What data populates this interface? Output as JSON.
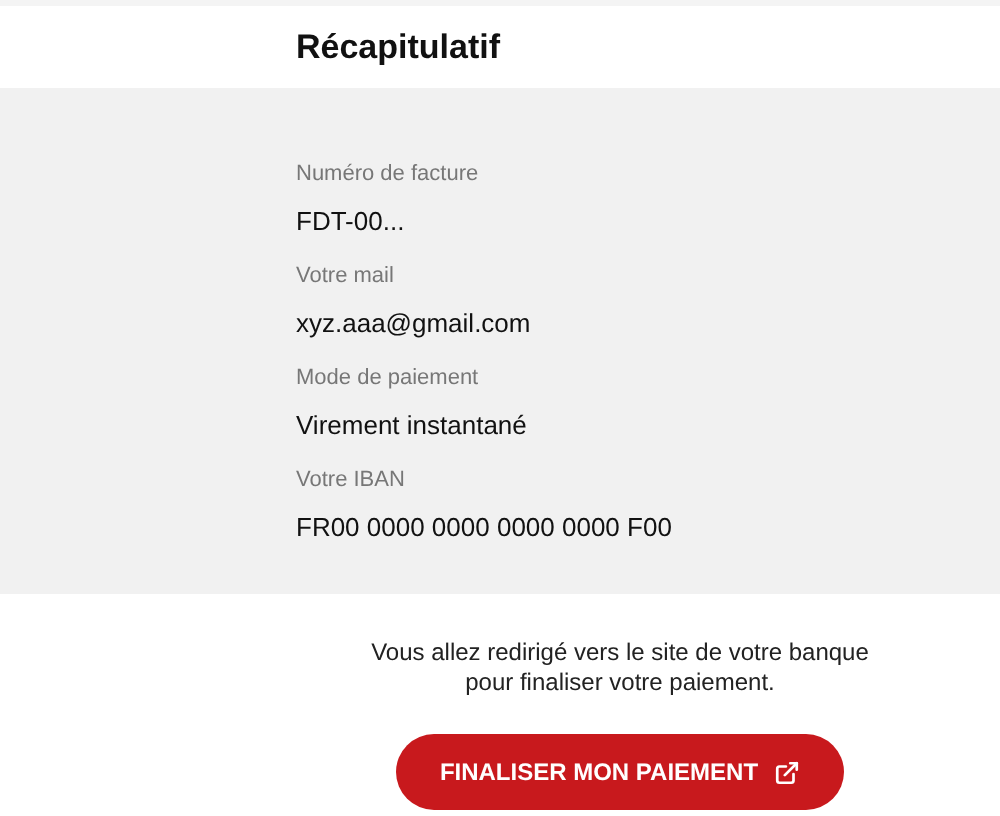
{
  "header": {
    "title": "Récapitulatif"
  },
  "summary": [
    {
      "label": "Numéro de facture",
      "value": "FDT-00..."
    },
    {
      "label": "Votre mail",
      "value": "xyz.aaa@gmail.com"
    },
    {
      "label": "Mode de paiement",
      "value": "Virement instantané"
    },
    {
      "label": "Votre IBAN",
      "value": "FR00 0000 0000 0000 0000 F00"
    }
  ],
  "notice": "Vous allez redirigé vers le site de votre banque pour finaliser votre paiement.",
  "button": {
    "label": "FINALISER MON PAIEMENT"
  }
}
